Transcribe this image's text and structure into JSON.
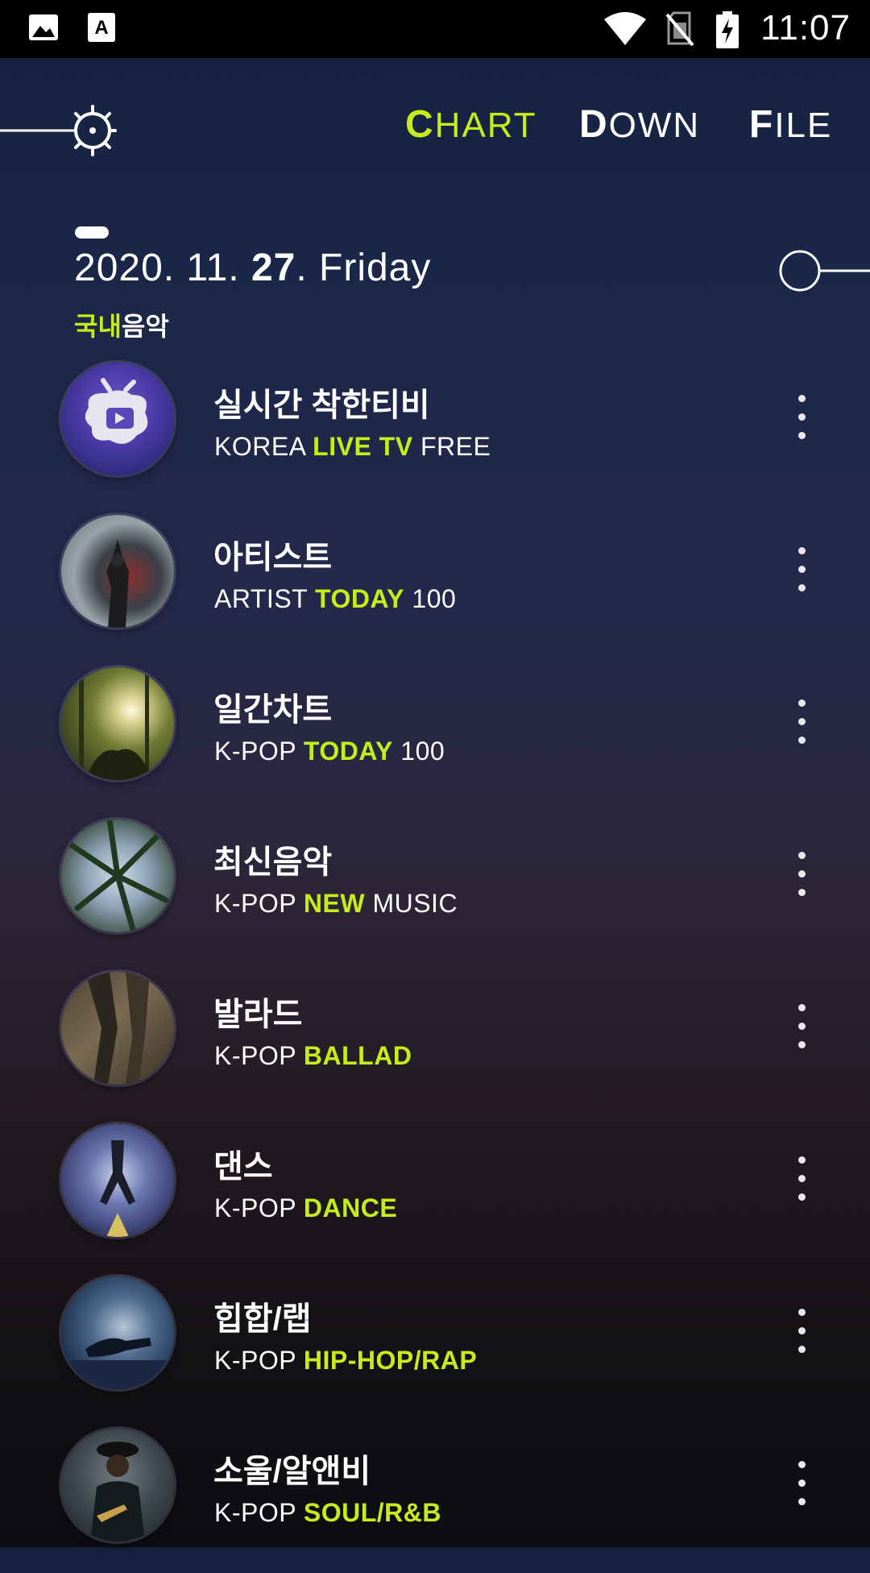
{
  "status_bar": {
    "time": "11:07",
    "icons": [
      "image-icon",
      "font-a-icon",
      "wifi-icon",
      "no-sim-icon",
      "battery-charging-icon"
    ]
  },
  "header": {
    "tabs": [
      {
        "first": "C",
        "rest": "HART",
        "active": true
      },
      {
        "first": "D",
        "rest": "OWN",
        "active": false
      },
      {
        "first": "F",
        "rest": "ILE",
        "active": false
      }
    ]
  },
  "date": {
    "prefix": "2020. 11. ",
    "day": "27",
    "suffix": ". Friday"
  },
  "category": {
    "highlight": "국내",
    "rest": "음악"
  },
  "items": [
    {
      "title": "실시간 착한티비",
      "sub": [
        "KOREA ",
        "LIVE TV",
        " FREE"
      ]
    },
    {
      "title": "아티스트",
      "sub": [
        "ARTIST ",
        "TODAY",
        " 100"
      ]
    },
    {
      "title": "일간차트",
      "sub": [
        "K-POP ",
        "TODAY",
        " 100"
      ]
    },
    {
      "title": "최신음악",
      "sub": [
        "K-POP ",
        "NEW",
        " MUSIC"
      ]
    },
    {
      "title": "발라드",
      "sub": [
        "K-POP ",
        "BALLAD",
        ""
      ]
    },
    {
      "title": "댄스",
      "sub": [
        "K-POP ",
        "DANCE",
        ""
      ]
    },
    {
      "title": "힙합/랩",
      "sub": [
        "K-POP ",
        "HIP-HOP/RAP",
        ""
      ]
    },
    {
      "title": "소울/알앤비",
      "sub": [
        "K-POP ",
        "SOUL/R&B",
        ""
      ]
    }
  ],
  "colors": {
    "accent": "#c7ec1c",
    "statusbar": "#000000"
  }
}
